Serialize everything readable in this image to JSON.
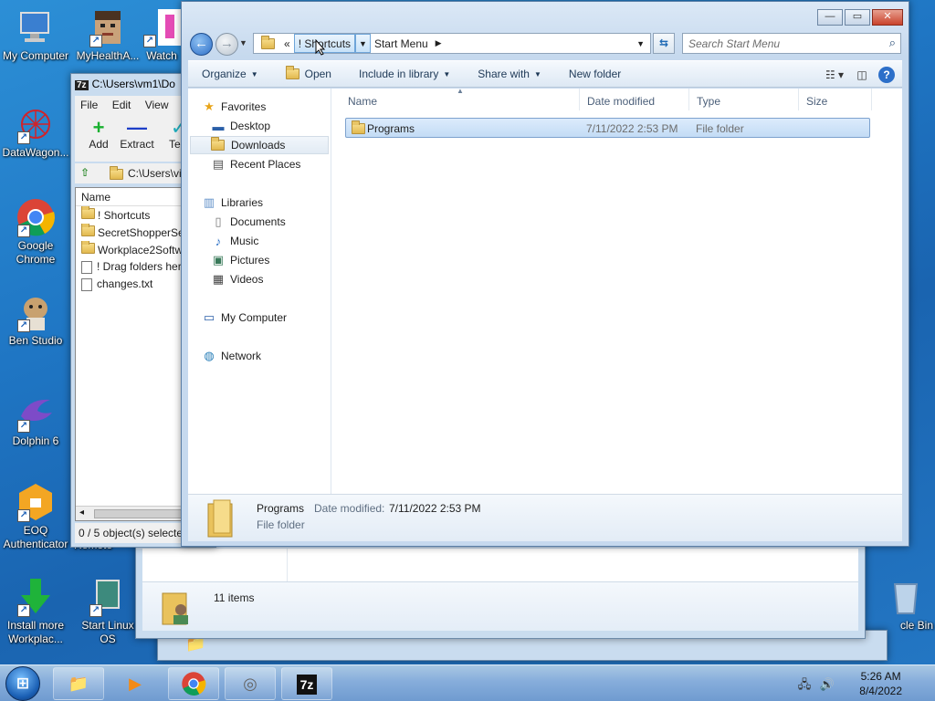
{
  "colors": {
    "desktop": "#1f76c4",
    "selection": "#c3dcf5",
    "window_frame": "#c6d9ee",
    "taskbar": "#86addb"
  },
  "desktop_icons": [
    {
      "label": "My Computer",
      "icon": "computer-icon"
    },
    {
      "label": "MyHealthA...",
      "icon": "pixel-face-icon"
    },
    {
      "label": "Watch",
      "icon": "pink-app-icon"
    },
    {
      "label": "DataWagon...",
      "icon": "network-graph-icon"
    },
    {
      "label": "Google Chrome",
      "icon": "chrome-icon"
    },
    {
      "label": "Ben Studio",
      "icon": "dog-icon"
    },
    {
      "label": "Dolphin 6",
      "icon": "dolphin-icon"
    },
    {
      "label": "EOQ Authenticator",
      "icon": "lock-shield-icon"
    },
    {
      "label": "Remote",
      "icon": "remote-icon"
    },
    {
      "label": "Install more Workplac...",
      "icon": "download-arrow-icon"
    },
    {
      "label": "Start Linux OS",
      "icon": "linux-icon"
    },
    {
      "label": "cle Bin",
      "icon": "recycle-bin-icon"
    }
  ],
  "zip_window": {
    "title_icon": "7z",
    "title": "C:\\Users\\vm1\\Do",
    "menu": [
      "File",
      "Edit",
      "View"
    ],
    "tools": [
      {
        "label": "Add",
        "icon": "plus-icon"
      },
      {
        "label": "Extract",
        "icon": "minus-icon"
      },
      {
        "label": "Test",
        "icon": "checkmark-icon"
      }
    ],
    "address": "C:\\Users\\vi",
    "column_name": "Name",
    "files": [
      {
        "name": "! Shortcuts",
        "kind": "folder"
      },
      {
        "name": "SecretShopperSer",
        "kind": "folder"
      },
      {
        "name": "Workplace2Softw",
        "kind": "folder"
      },
      {
        "name": "! Drag folders her",
        "kind": "file"
      },
      {
        "name": "changes.txt",
        "kind": "file"
      }
    ],
    "status": "0 / 5 object(s) selecte"
  },
  "bg_explorer": {
    "item_count": "11 items"
  },
  "explorer": {
    "breadcrumb": {
      "overflow": "«",
      "items": [
        "! Shortcuts",
        "Start Menu"
      ]
    },
    "search_placeholder": "Search Start Menu",
    "commands": [
      {
        "label": "Organize",
        "dropdown": true
      },
      {
        "label": "Open",
        "dropdown": false
      },
      {
        "label": "Include in library",
        "dropdown": true
      },
      {
        "label": "Share with",
        "dropdown": true
      },
      {
        "label": "New folder",
        "dropdown": false
      }
    ],
    "nav": {
      "favorites_label": "Favorites",
      "favorites": [
        "Desktop",
        "Downloads",
        "Recent Places"
      ],
      "libraries_label": "Libraries",
      "libraries": [
        "Documents",
        "Music",
        "Pictures",
        "Videos"
      ],
      "computer": "My Computer",
      "network": "Network"
    },
    "columns": [
      "Name",
      "Date modified",
      "Type",
      "Size"
    ],
    "rows": [
      {
        "name": "Programs",
        "date": "7/11/2022 2:53 PM",
        "type": "File folder",
        "size": ""
      }
    ],
    "details": {
      "name": "Programs",
      "date_label": "Date modified:",
      "date": "7/11/2022 2:53 PM",
      "type": "File folder"
    }
  },
  "taskbar": {
    "time": "5:26 AM",
    "date": "8/4/2022",
    "pinned": [
      {
        "icon": "file-explorer-icon"
      },
      {
        "icon": "media-player-icon"
      },
      {
        "icon": "chrome-icon"
      },
      {
        "icon": "disc-burner-icon"
      },
      {
        "icon": "7zip-icon",
        "label": "7z"
      }
    ]
  }
}
